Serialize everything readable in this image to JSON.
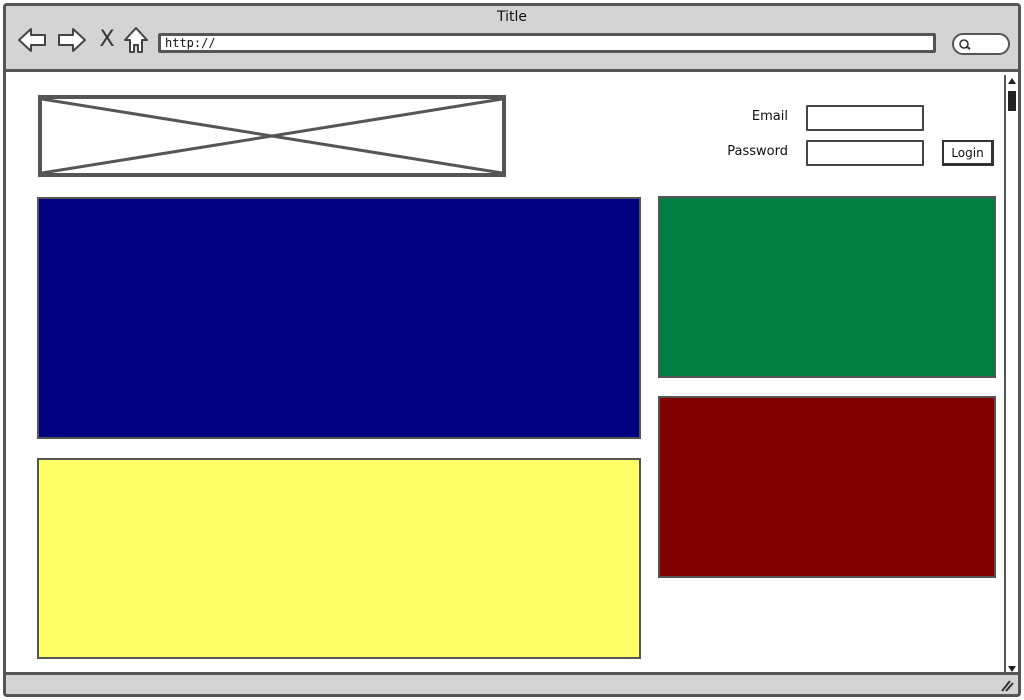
{
  "window": {
    "title": "Title",
    "url": "http://"
  },
  "nav": {
    "back_icon": "back-arrow-icon",
    "forward_icon": "forward-arrow-icon",
    "stop_glyph": "X",
    "home_icon": "home-icon"
  },
  "header": {
    "logo": "image-placeholder-icon"
  },
  "login": {
    "email_label": "Email",
    "email_value": "",
    "password_label": "Password",
    "password_value": "",
    "button_label": "Login"
  },
  "blocks": {
    "main_top_color": "#000080",
    "main_bottom_color": "#ffff66",
    "side_top_color": "#008040",
    "side_bottom_color": "#800000"
  }
}
